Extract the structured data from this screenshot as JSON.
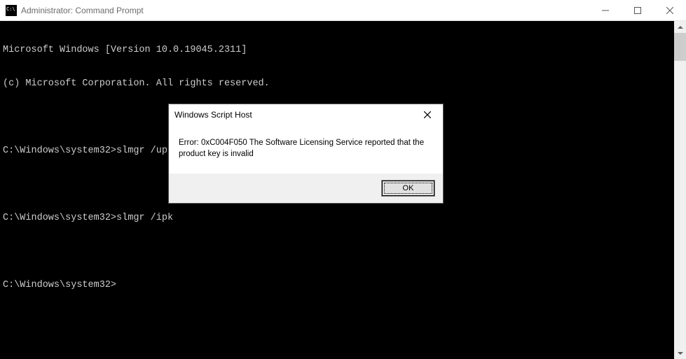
{
  "window": {
    "title": "Administrator: Command Prompt"
  },
  "console": {
    "lines": [
      "Microsoft Windows [Version 10.0.19045.2311]",
      "(c) Microsoft Corporation. All rights reserved.",
      "",
      "C:\\Windows\\system32>slmgr /upk",
      "",
      "C:\\Windows\\system32>slmgr /ipk",
      "",
      "C:\\Windows\\system32>"
    ]
  },
  "dialog": {
    "title": "Windows Script Host",
    "message": "Error: 0xC004F050 The Software Licensing Service reported that the product key is invalid",
    "ok_label": "OK"
  }
}
